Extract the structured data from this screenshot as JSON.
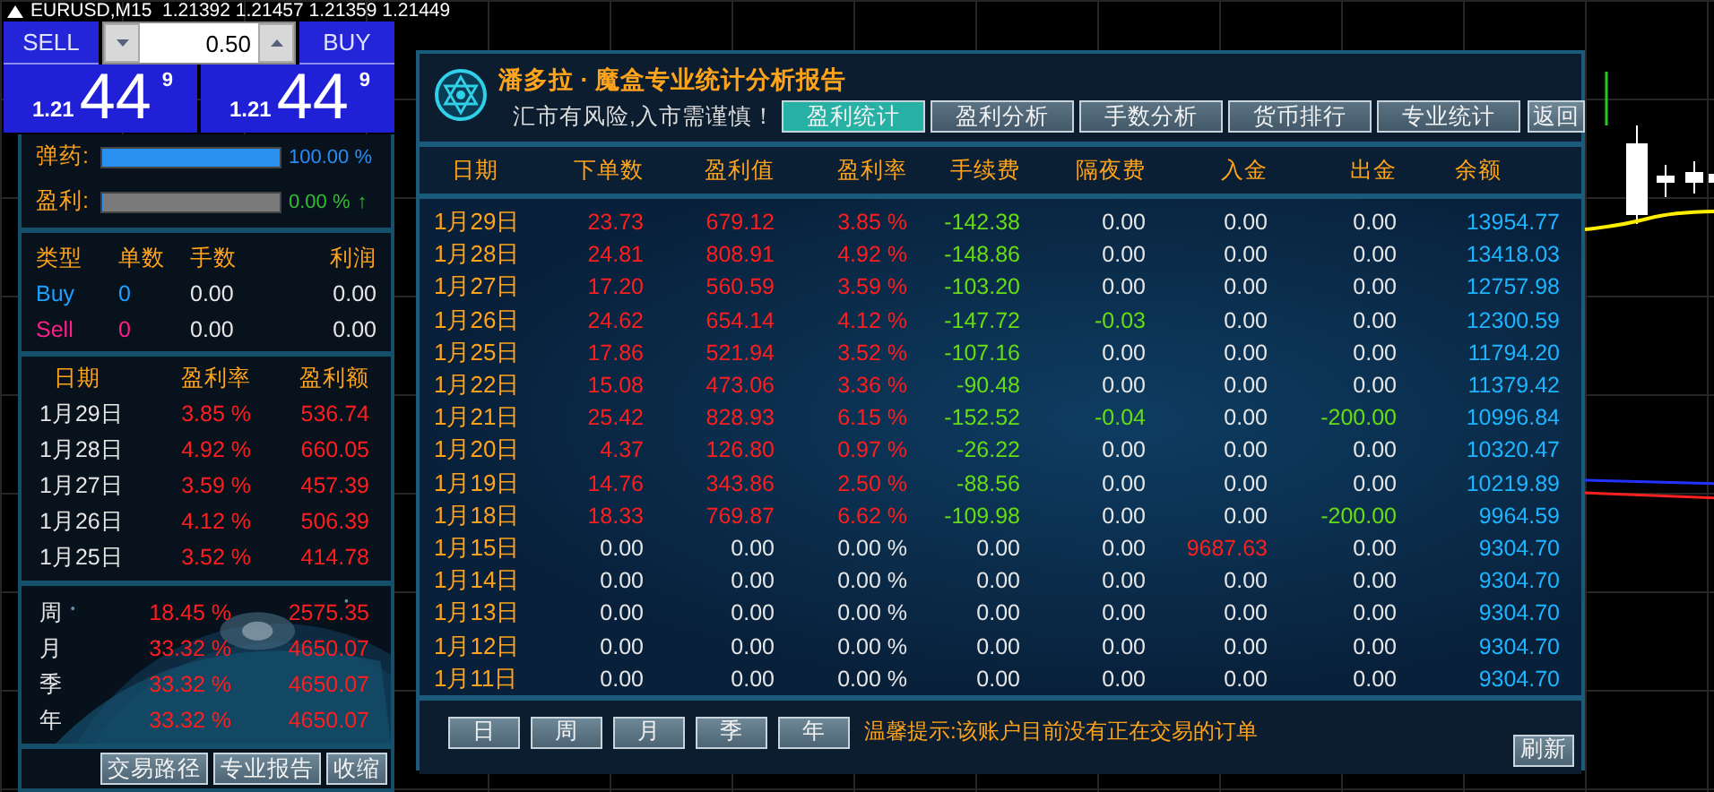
{
  "symbol_bar": {
    "text": "EURUSD,M15  1.21392 1.21457 1.21359 1.21449"
  },
  "trade": {
    "sell_label": "SELL",
    "buy_label": "BUY",
    "lot": "0.50",
    "sell_price": {
      "prefix": "1.21",
      "big": "44",
      "sup": "9"
    },
    "buy_price": {
      "prefix": "1.21",
      "big": "44",
      "sup": "9"
    }
  },
  "meters": [
    {
      "label": "弹药:",
      "level": 1,
      "reading": "100.00 %",
      "color": "#2a8cf0"
    },
    {
      "label": "盈利:",
      "level": 0,
      "reading": "0.00 %",
      "trend": "↑",
      "color": "#33bb33"
    }
  ],
  "positions": {
    "columns": [
      "类型",
      "单数",
      "手数",
      "利润"
    ],
    "rows": [
      {
        "type": "Buy",
        "count": "0",
        "lots": "0.00",
        "profit": "0.00",
        "color": "#1ea0ff"
      },
      {
        "type": "Sell",
        "count": "0",
        "lots": "0.00",
        "profit": "0.00",
        "color": "#ff1e8c"
      }
    ]
  },
  "daily": {
    "columns": [
      "日期",
      "盈利率",
      "盈利额"
    ],
    "rows": [
      {
        "date": "1月29日",
        "rate": "3.85 %",
        "amount": "536.74"
      },
      {
        "date": "1月28日",
        "rate": "4.92 %",
        "amount": "660.05"
      },
      {
        "date": "1月27日",
        "rate": "3.59 %",
        "amount": "457.39"
      },
      {
        "date": "1月26日",
        "rate": "4.12 %",
        "amount": "506.39"
      },
      {
        "date": "1月25日",
        "rate": "3.52 %",
        "amount": "414.78"
      }
    ]
  },
  "summary": [
    {
      "period": "周",
      "rate": "18.45 %",
      "amount": "2575.35"
    },
    {
      "period": "月",
      "rate": "33.32 %",
      "amount": "4650.07"
    },
    {
      "period": "季",
      "rate": "33.32 %",
      "amount": "4650.07"
    },
    {
      "period": "年",
      "rate": "33.32 %",
      "amount": "4650.07"
    }
  ],
  "left_buttons": [
    "交易路径",
    "专业报告",
    "收缩"
  ],
  "report": {
    "title": "潘多拉 · 魔盒专业统计分析报告",
    "subtitle": "汇市有风险,入市需谨慎！",
    "tabs": [
      {
        "label": "盈利统计",
        "selected": true
      },
      {
        "label": "盈利分析",
        "selected": false
      },
      {
        "label": "手数分析",
        "selected": false
      },
      {
        "label": "货币排行",
        "selected": false
      },
      {
        "label": "专业统计",
        "selected": false
      }
    ],
    "back_label": "返回",
    "columns": [
      "日期",
      "下单数",
      "盈利值",
      "盈利率",
      "手续费",
      "隔夜费",
      "入金",
      "出金",
      "余额"
    ],
    "rows": [
      {
        "cells": [
          {
            "text": "1月29日",
            "color": "#ffa31a"
          },
          {
            "text": "23.73",
            "color": "#ff1e1e"
          },
          {
            "text": "679.12",
            "color": "#ff1e1e"
          },
          {
            "text": "3.85 %",
            "color": "#ff1e1e"
          },
          {
            "text": "-142.38",
            "color": "#66dd11"
          },
          {
            "text": "0.00",
            "color": "#e6e6e6"
          },
          {
            "text": "0.00",
            "color": "#e6e6e6"
          },
          {
            "text": "0.00",
            "color": "#e6e6e6"
          },
          {
            "text": "13954.77",
            "color": "#1eb4ff"
          }
        ]
      },
      {
        "cells": [
          {
            "text": "1月28日",
            "color": "#ffa31a"
          },
          {
            "text": "24.81",
            "color": "#ff1e1e"
          },
          {
            "text": "808.91",
            "color": "#ff1e1e"
          },
          {
            "text": "4.92 %",
            "color": "#ff1e1e"
          },
          {
            "text": "-148.86",
            "color": "#66dd11"
          },
          {
            "text": "0.00",
            "color": "#e6e6e6"
          },
          {
            "text": "0.00",
            "color": "#e6e6e6"
          },
          {
            "text": "0.00",
            "color": "#e6e6e6"
          },
          {
            "text": "13418.03",
            "color": "#1eb4ff"
          }
        ]
      },
      {
        "cells": [
          {
            "text": "1月27日",
            "color": "#ffa31a"
          },
          {
            "text": "17.20",
            "color": "#ff1e1e"
          },
          {
            "text": "560.59",
            "color": "#ff1e1e"
          },
          {
            "text": "3.59 %",
            "color": "#ff1e1e"
          },
          {
            "text": "-103.20",
            "color": "#66dd11"
          },
          {
            "text": "0.00",
            "color": "#e6e6e6"
          },
          {
            "text": "0.00",
            "color": "#e6e6e6"
          },
          {
            "text": "0.00",
            "color": "#e6e6e6"
          },
          {
            "text": "12757.98",
            "color": "#1eb4ff"
          }
        ]
      },
      {
        "cells": [
          {
            "text": "1月26日",
            "color": "#ffa31a"
          },
          {
            "text": "24.62",
            "color": "#ff1e1e"
          },
          {
            "text": "654.14",
            "color": "#ff1e1e"
          },
          {
            "text": "4.12 %",
            "color": "#ff1e1e"
          },
          {
            "text": "-147.72",
            "color": "#66dd11"
          },
          {
            "text": "-0.03",
            "color": "#66dd11"
          },
          {
            "text": "0.00",
            "color": "#e6e6e6"
          },
          {
            "text": "0.00",
            "color": "#e6e6e6"
          },
          {
            "text": "12300.59",
            "color": "#1eb4ff"
          }
        ]
      },
      {
        "cells": [
          {
            "text": "1月25日",
            "color": "#ffa31a"
          },
          {
            "text": "17.86",
            "color": "#ff1e1e"
          },
          {
            "text": "521.94",
            "color": "#ff1e1e"
          },
          {
            "text": "3.52 %",
            "color": "#ff1e1e"
          },
          {
            "text": "-107.16",
            "color": "#66dd11"
          },
          {
            "text": "0.00",
            "color": "#e6e6e6"
          },
          {
            "text": "0.00",
            "color": "#e6e6e6"
          },
          {
            "text": "0.00",
            "color": "#e6e6e6"
          },
          {
            "text": "11794.20",
            "color": "#1eb4ff"
          }
        ]
      },
      {
        "cells": [
          {
            "text": "1月22日",
            "color": "#ffa31a"
          },
          {
            "text": "15.08",
            "color": "#ff1e1e"
          },
          {
            "text": "473.06",
            "color": "#ff1e1e"
          },
          {
            "text": "3.36 %",
            "color": "#ff1e1e"
          },
          {
            "text": "-90.48",
            "color": "#66dd11"
          },
          {
            "text": "0.00",
            "color": "#e6e6e6"
          },
          {
            "text": "0.00",
            "color": "#e6e6e6"
          },
          {
            "text": "0.00",
            "color": "#e6e6e6"
          },
          {
            "text": "11379.42",
            "color": "#1eb4ff"
          }
        ]
      },
      {
        "cells": [
          {
            "text": "1月21日",
            "color": "#ffa31a"
          },
          {
            "text": "25.42",
            "color": "#ff1e1e"
          },
          {
            "text": "828.93",
            "color": "#ff1e1e"
          },
          {
            "text": "6.15 %",
            "color": "#ff1e1e"
          },
          {
            "text": "-152.52",
            "color": "#66dd11"
          },
          {
            "text": "-0.04",
            "color": "#66dd11"
          },
          {
            "text": "0.00",
            "color": "#e6e6e6"
          },
          {
            "text": "-200.00",
            "color": "#66dd11"
          },
          {
            "text": "10996.84",
            "color": "#1eb4ff"
          }
        ]
      },
      {
        "cells": [
          {
            "text": "1月20日",
            "color": "#ffa31a"
          },
          {
            "text": "4.37",
            "color": "#ff1e1e"
          },
          {
            "text": "126.80",
            "color": "#ff1e1e"
          },
          {
            "text": "0.97 %",
            "color": "#ff1e1e"
          },
          {
            "text": "-26.22",
            "color": "#66dd11"
          },
          {
            "text": "0.00",
            "color": "#e6e6e6"
          },
          {
            "text": "0.00",
            "color": "#e6e6e6"
          },
          {
            "text": "0.00",
            "color": "#e6e6e6"
          },
          {
            "text": "10320.47",
            "color": "#1eb4ff"
          }
        ]
      },
      {
        "cells": [
          {
            "text": "1月19日",
            "color": "#ffa31a"
          },
          {
            "text": "14.76",
            "color": "#ff1e1e"
          },
          {
            "text": "343.86",
            "color": "#ff1e1e"
          },
          {
            "text": "2.50 %",
            "color": "#ff1e1e"
          },
          {
            "text": "-88.56",
            "color": "#66dd11"
          },
          {
            "text": "0.00",
            "color": "#e6e6e6"
          },
          {
            "text": "0.00",
            "color": "#e6e6e6"
          },
          {
            "text": "0.00",
            "color": "#e6e6e6"
          },
          {
            "text": "10219.89",
            "color": "#1eb4ff"
          }
        ]
      },
      {
        "cells": [
          {
            "text": "1月18日",
            "color": "#ffa31a"
          },
          {
            "text": "18.33",
            "color": "#ff1e1e"
          },
          {
            "text": "769.87",
            "color": "#ff1e1e"
          },
          {
            "text": "6.62 %",
            "color": "#ff1e1e"
          },
          {
            "text": "-109.98",
            "color": "#66dd11"
          },
          {
            "text": "0.00",
            "color": "#e6e6e6"
          },
          {
            "text": "0.00",
            "color": "#e6e6e6"
          },
          {
            "text": "-200.00",
            "color": "#66dd11"
          },
          {
            "text": "9964.59",
            "color": "#1eb4ff"
          }
        ]
      },
      {
        "cells": [
          {
            "text": "1月15日",
            "color": "#ffa31a"
          },
          {
            "text": "0.00",
            "color": "#e6e6e6"
          },
          {
            "text": "0.00",
            "color": "#e6e6e6"
          },
          {
            "text": "0.00 %",
            "color": "#e6e6e6"
          },
          {
            "text": "0.00",
            "color": "#e6e6e6"
          },
          {
            "text": "0.00",
            "color": "#e6e6e6"
          },
          {
            "text": "9687.63",
            "color": "#ff1e1e"
          },
          {
            "text": "0.00",
            "color": "#e6e6e6"
          },
          {
            "text": "9304.70",
            "color": "#1eb4ff"
          }
        ]
      },
      {
        "cells": [
          {
            "text": "1月14日",
            "color": "#ffa31a"
          },
          {
            "text": "0.00",
            "color": "#e6e6e6"
          },
          {
            "text": "0.00",
            "color": "#e6e6e6"
          },
          {
            "text": "0.00 %",
            "color": "#e6e6e6"
          },
          {
            "text": "0.00",
            "color": "#e6e6e6"
          },
          {
            "text": "0.00",
            "color": "#e6e6e6"
          },
          {
            "text": "0.00",
            "color": "#e6e6e6"
          },
          {
            "text": "0.00",
            "color": "#e6e6e6"
          },
          {
            "text": "9304.70",
            "color": "#1eb4ff"
          }
        ]
      },
      {
        "cells": [
          {
            "text": "1月13日",
            "color": "#ffa31a"
          },
          {
            "text": "0.00",
            "color": "#e6e6e6"
          },
          {
            "text": "0.00",
            "color": "#e6e6e6"
          },
          {
            "text": "0.00 %",
            "color": "#e6e6e6"
          },
          {
            "text": "0.00",
            "color": "#e6e6e6"
          },
          {
            "text": "0.00",
            "color": "#e6e6e6"
          },
          {
            "text": "0.00",
            "color": "#e6e6e6"
          },
          {
            "text": "0.00",
            "color": "#e6e6e6"
          },
          {
            "text": "9304.70",
            "color": "#1eb4ff"
          }
        ]
      },
      {
        "cells": [
          {
            "text": "1月12日",
            "color": "#ffa31a"
          },
          {
            "text": "0.00",
            "color": "#e6e6e6"
          },
          {
            "text": "0.00",
            "color": "#e6e6e6"
          },
          {
            "text": "0.00 %",
            "color": "#e6e6e6"
          },
          {
            "text": "0.00",
            "color": "#e6e6e6"
          },
          {
            "text": "0.00",
            "color": "#e6e6e6"
          },
          {
            "text": "0.00",
            "color": "#e6e6e6"
          },
          {
            "text": "0.00",
            "color": "#e6e6e6"
          },
          {
            "text": "9304.70",
            "color": "#1eb4ff"
          }
        ]
      },
      {
        "cells": [
          {
            "text": "1月11日",
            "color": "#ffa31a"
          },
          {
            "text": "0.00",
            "color": "#e6e6e6"
          },
          {
            "text": "0.00",
            "color": "#e6e6e6"
          },
          {
            "text": "0.00 %",
            "color": "#e6e6e6"
          },
          {
            "text": "0.00",
            "color": "#e6e6e6"
          },
          {
            "text": "0.00",
            "color": "#e6e6e6"
          },
          {
            "text": "0.00",
            "color": "#e6e6e6"
          },
          {
            "text": "0.00",
            "color": "#e6e6e6"
          },
          {
            "text": "9304.70",
            "color": "#1eb4ff"
          }
        ]
      }
    ],
    "period_buttons": [
      "日",
      "周",
      "月",
      "季",
      "年"
    ],
    "notice": "温馨提示:该账户目前没有正在交易的订单",
    "refresh_label": "刷新"
  }
}
